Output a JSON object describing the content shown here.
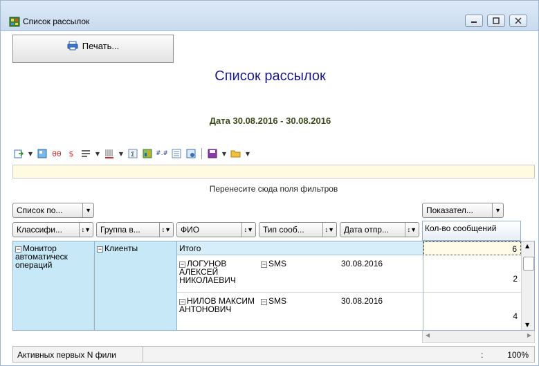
{
  "window": {
    "title": "Список рассылок"
  },
  "toolbar": {
    "print_label": "Печать..."
  },
  "report": {
    "title": "Список рассылок",
    "date_range": "Дата 30.08.2016 - 30.08.2016"
  },
  "filter_area": {
    "hint": "Перенесите сюда поля фильтров"
  },
  "fields": {
    "page_field": "Список по...",
    "data_field": "Показател...",
    "row_fields": [
      "Классифи...",
      "Группа в...",
      "ФИО",
      "Тип сооб...",
      "Дата отпр..."
    ],
    "column_header": "Кол-во сообщений"
  },
  "grid": {
    "classifier": "Монитор автоматическ операций",
    "group": "Клиенты",
    "total_label": "Итого",
    "total_value": "6",
    "rows": [
      {
        "fio": "ЛОГУНОВ АЛЕКСЕЙ НИКОЛАЕВИЧ",
        "type": "SMS",
        "date": "30.08.2016",
        "count": "2"
      },
      {
        "fio": "НИЛОВ МАКСИМ АНТОНОВИЧ",
        "type": "SMS",
        "date": "30.08.2016",
        "count": "4"
      }
    ]
  },
  "statusbar": {
    "text": "Активных первых N фили",
    "separator": ":",
    "zoom": "100%"
  }
}
